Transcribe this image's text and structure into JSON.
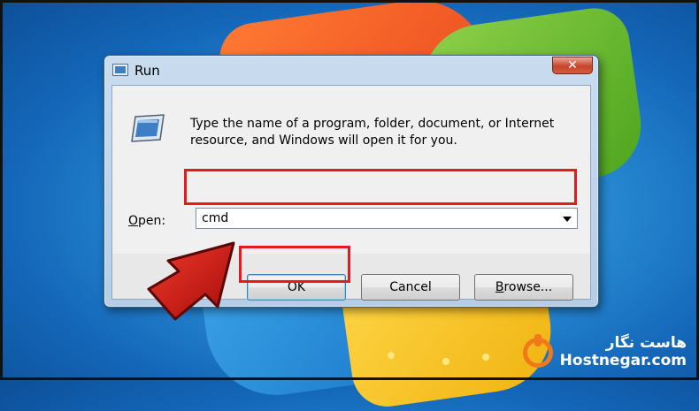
{
  "dialog": {
    "title": "Run",
    "close_glyph": "✕",
    "description": "Type the name of a program, folder, document, or Internet resource, and Windows will open it for you.",
    "open_label_mnemonic": "O",
    "open_label_rest": "pen:",
    "open_value": "cmd",
    "buttons": {
      "ok": "OK",
      "cancel": "Cancel",
      "browse_mnemonic": "B",
      "browse_rest": "rowse..."
    }
  },
  "highlight_color": "#e8181f",
  "arrow_color": "#d01a1a",
  "brand": {
    "name_fa": "هاست نگار",
    "name_en": "Hostnegar.com",
    "logo_color": "#f07a1a"
  },
  "icons": {
    "run": "run-program-icon",
    "close": "close-icon",
    "dropdown": "chevron-down-icon",
    "pointer": "red-arrow-icon"
  }
}
